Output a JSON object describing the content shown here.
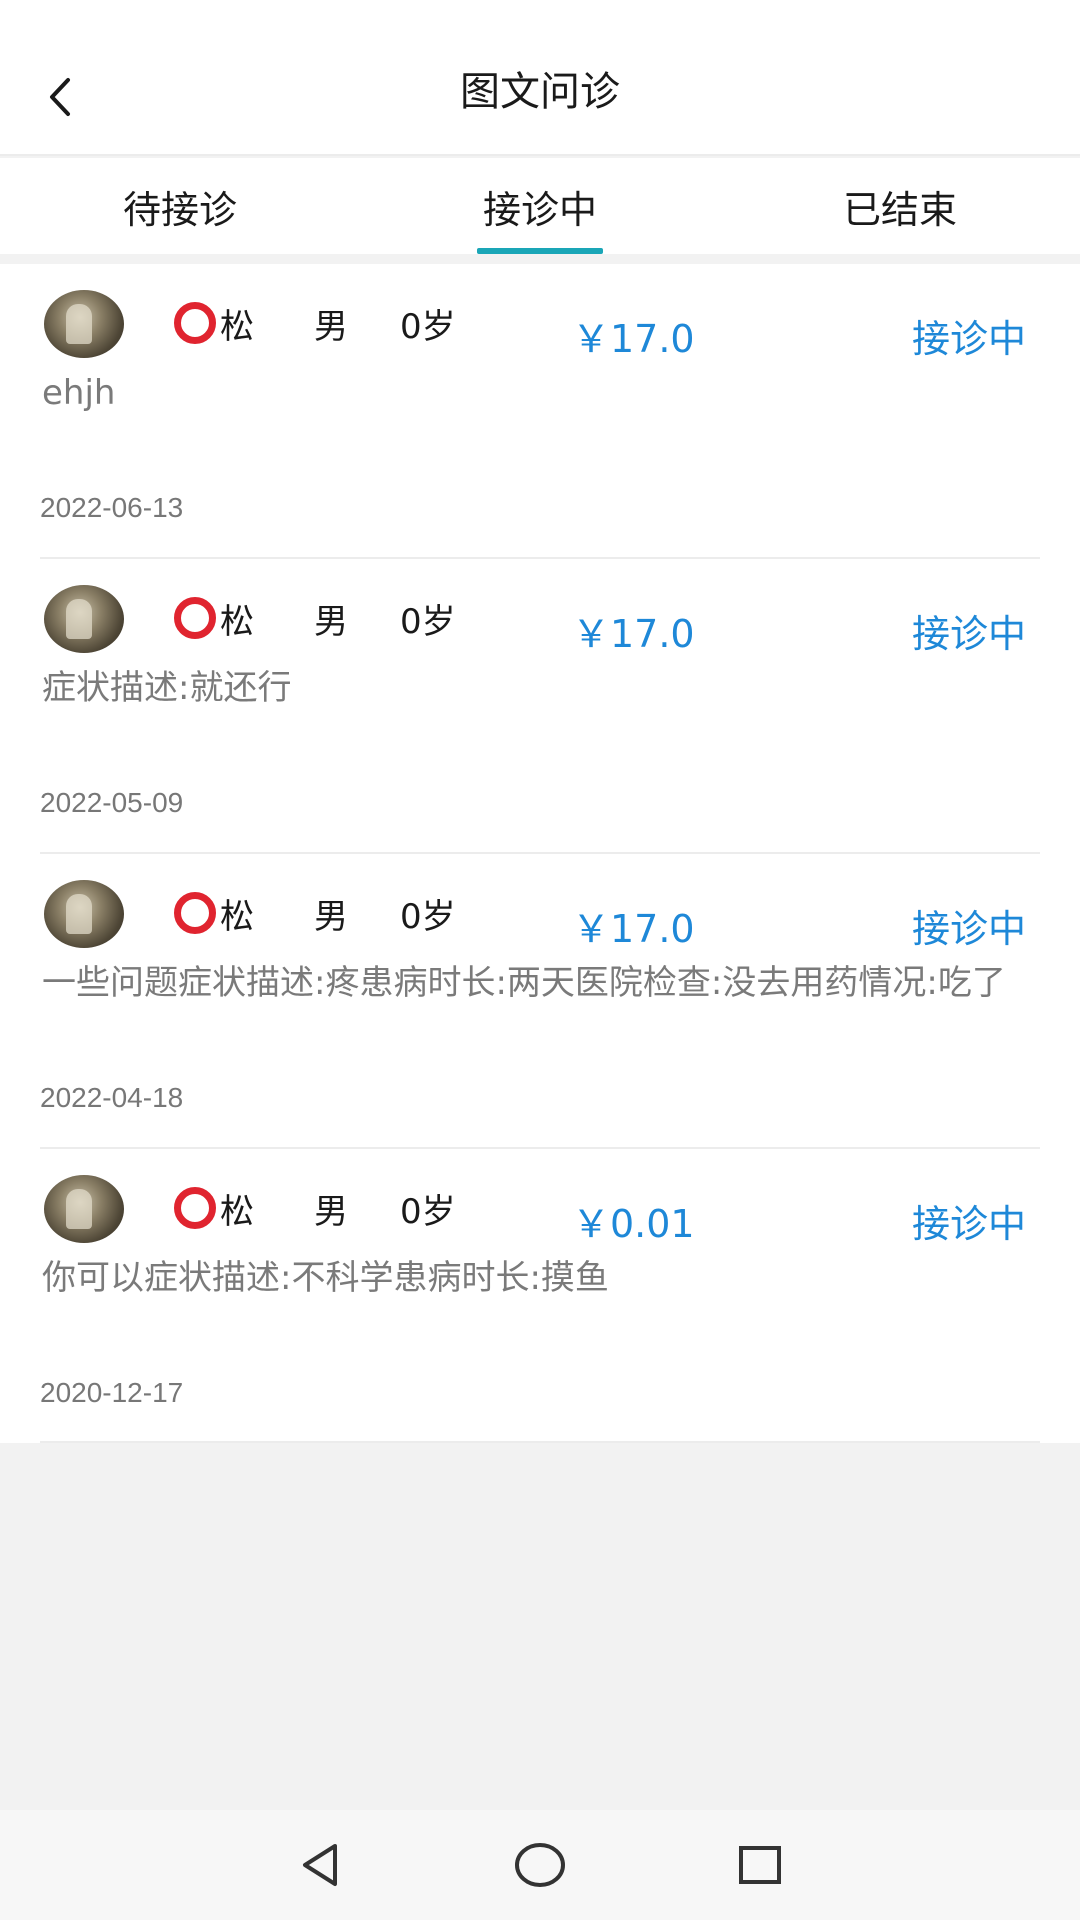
{
  "header": {
    "title": "图文问诊",
    "back_icon": "chevron-left-icon"
  },
  "tabs": [
    {
      "label": "待接诊",
      "active": false
    },
    {
      "label": "接诊中",
      "active": true
    },
    {
      "label": "已结束",
      "active": false
    }
  ],
  "accent_color": "#1aa6b7",
  "price_color": "#1e88d8",
  "cards": [
    {
      "name": "松",
      "gender": "男",
      "age": "0岁",
      "price": "￥17.0",
      "status": "接诊中",
      "description": "ehjh",
      "date": "2022-06-13"
    },
    {
      "name": "松",
      "gender": "男",
      "age": "0岁",
      "price": "￥17.0",
      "status": "接诊中",
      "description": "症状描述:就还行",
      "date": "2022-05-09"
    },
    {
      "name": "松",
      "gender": "男",
      "age": "0岁",
      "price": "￥17.0",
      "status": "接诊中",
      "description": "一些问题症状描述:疼患病时长:两天医院检查:没去用药情况:吃了",
      "date": "2022-04-18"
    },
    {
      "name": "松",
      "gender": "男",
      "age": "0岁",
      "price": "￥0.01",
      "status": "接诊中",
      "description": "你可以症状描述:不科学患病时长:摸鱼",
      "date": "2020-12-17"
    }
  ],
  "navbar": {
    "back_icon": "triangle-back-icon",
    "home_icon": "circle-home-icon",
    "recent_icon": "square-recent-icon"
  }
}
